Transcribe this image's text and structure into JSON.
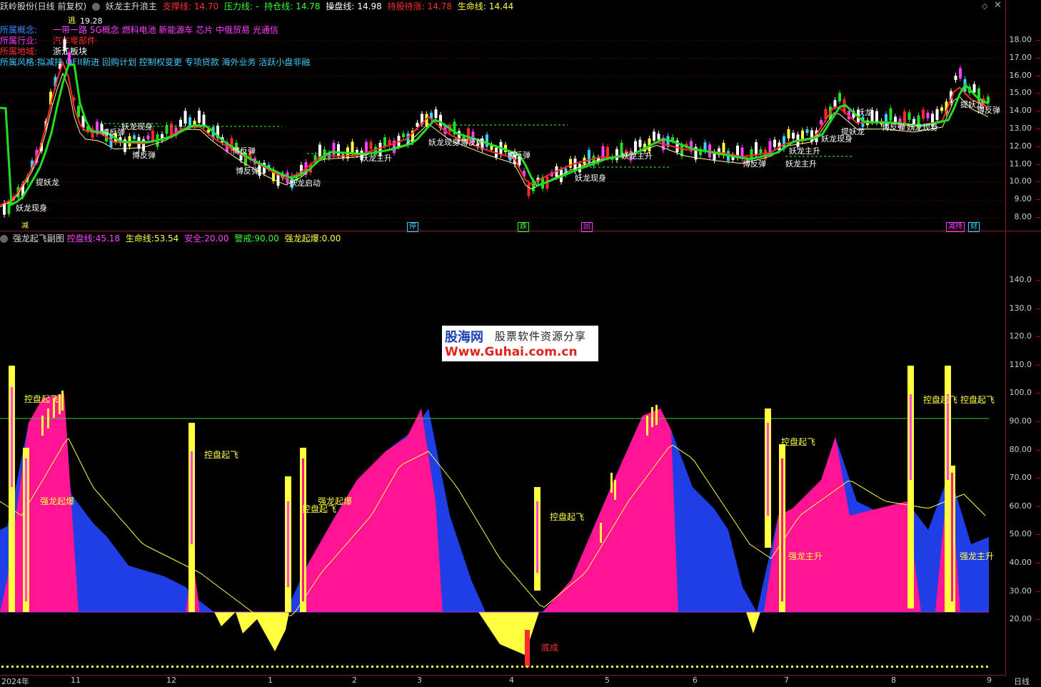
{
  "header": {
    "stock": "跃岭股份(日线 前复权)",
    "indicator": "妖龙主升浪主",
    "support_label": "支撑线:",
    "support_value": "14.70",
    "pressure_label": "压力线:",
    "pressure_value": "-",
    "hold_label": "持仓线:",
    "hold_value": "14.78",
    "control_label": "操盘线:",
    "control_value": "14.98",
    "hold_wait_label": "持股待涨:",
    "hold_wait_value": "14.78",
    "life_label": "生命线:",
    "life_value": "14.44"
  },
  "concepts": {
    "concept_label": "所属概念:",
    "concept_value": "一带一路 5G概念 燃料电池 新能源车 芯片 中俄贸易 光通信",
    "industry_label": "所属行业:",
    "industry_value": "汽车零部件",
    "region_label": "所属地域:",
    "region_value": "浙江板块",
    "style_label": "所属风格:",
    "style_value": "拟减持 QFII新进 回购计划 控制权变更 专项贷款 海外业务 活跃小盘非融"
  },
  "peak_label": "19.28",
  "escape_label": "逃",
  "main_axis": [
    "18.00",
    "17.00",
    "16.00",
    "15.00",
    "14.00",
    "13.00",
    "12.00",
    "11.00",
    "10.00",
    "9.00",
    "8.00"
  ],
  "main_annotations": [
    "提妖龙",
    "妖龙现身",
    "博反弹",
    "博反弹",
    "妖龙启动",
    "妖龙现身",
    "妖龙主升",
    "博反弹",
    "博反弹",
    "妖龙现身",
    "博反弹",
    "博反弹",
    "妖龙主升",
    "博反弹",
    "妖龙主升",
    "提妖龙",
    "妖龙现身",
    "妖龙主升",
    "妖龙",
    "博反弹",
    "提妖龙",
    "妖龙现身",
    "博反弹",
    "妖龙现身"
  ],
  "main_markers": [
    "减",
    "停",
    "跌",
    "回",
    "减持",
    "财"
  ],
  "sub": {
    "title": "强龙起飞副图",
    "control_label": "控盘线:",
    "control_value": "45.18",
    "life_label": "生命线:",
    "life_value": "53.54",
    "safe_label": "安全:",
    "safe_value": "20.00",
    "alert_label": "警戒:",
    "alert_value": "90.00",
    "burst_label": "强龙起爆:",
    "burst_value": "0.00"
  },
  "sub_axis": [
    "140.0",
    "130.0",
    "120.0",
    "110.0",
    "100.0",
    "90.00",
    "80.00",
    "70.00",
    "60.00",
    "50.00",
    "40.00",
    "30.00",
    "20.00"
  ],
  "sub_annotations": [
    "控盘起飞",
    "强龙起爆",
    "控盘起飞",
    "强龙起爆",
    "控盘起飞",
    "控盘起飞",
    "底成",
    "控盘起飞",
    "强龙主升",
    "控盘起飞",
    "控盘起飞",
    "强龙主升"
  ],
  "watermark": {
    "brand": "股海网",
    "slogan": "股票软件资源分享",
    "url": "Www.Guhai.com.cn"
  },
  "x_axis": [
    "2024年",
    "11",
    "12",
    "1",
    "2",
    "3",
    "4",
    "5",
    "6",
    "7",
    "8",
    "9"
  ],
  "period": "日线",
  "colors": {
    "pink": "#ff1493",
    "blue": "#1f3ee6",
    "yellow": "#ffff40",
    "red_line": "#ff2a2a",
    "green_line": "#22dd22"
  }
}
